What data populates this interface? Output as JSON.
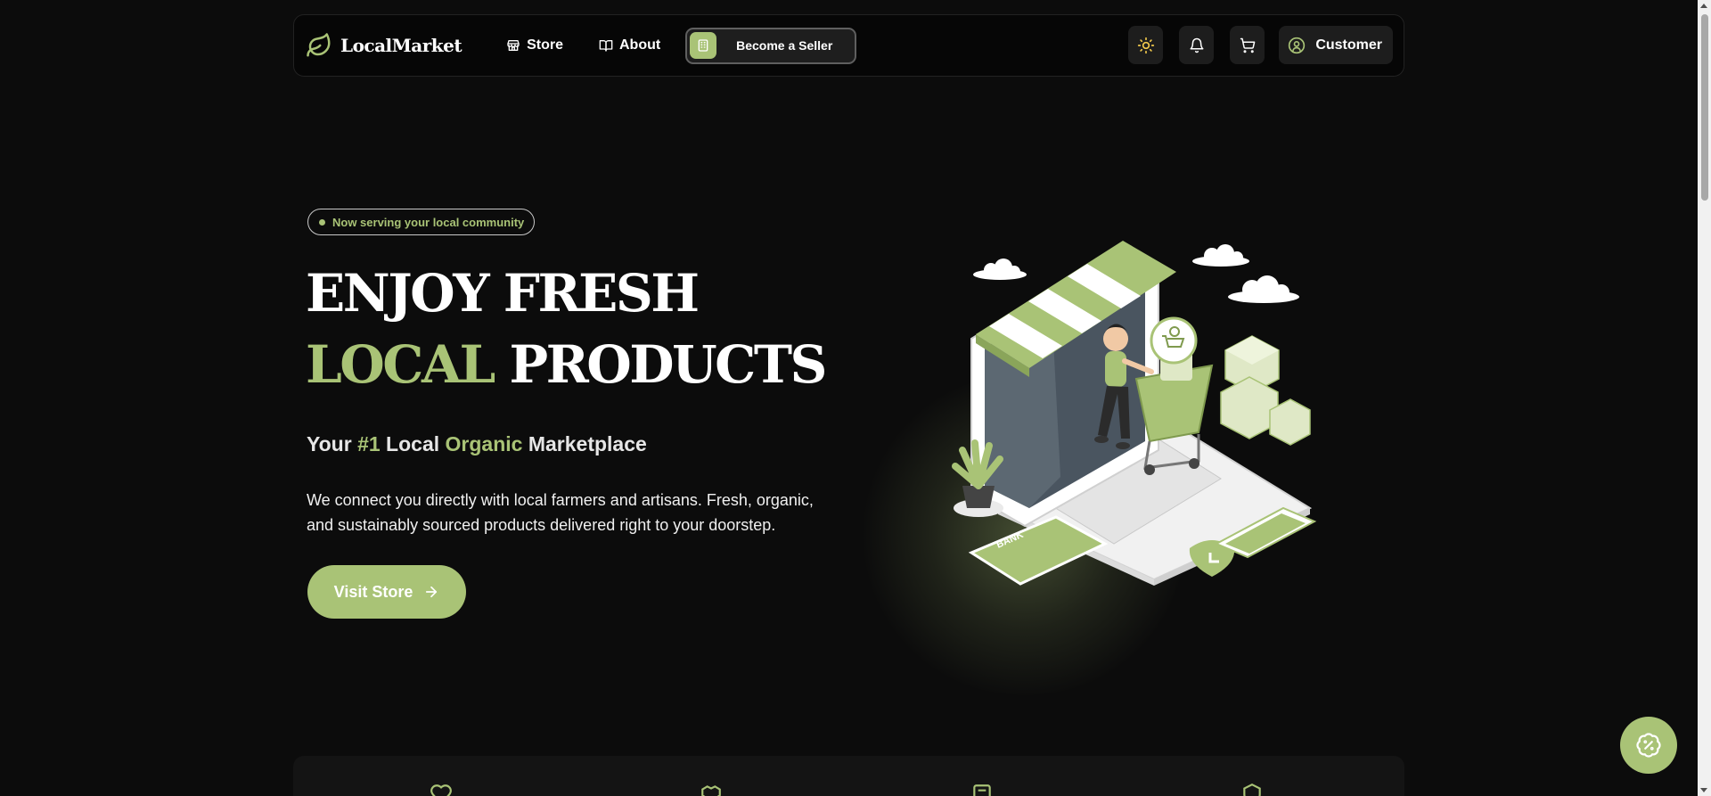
{
  "nav": {
    "brand": "LocalMarket",
    "links": [
      {
        "label": "Store",
        "icon": "store-icon"
      },
      {
        "label": "About",
        "icon": "book-icon"
      }
    ],
    "seller_label": "Become a Seller",
    "customer_label": "Customer"
  },
  "hero": {
    "badge": "Now serving your local community",
    "title_line1": "ENJOY FRESH",
    "title_line2_accent": "LOCAL",
    "title_line2_rest": "PRODUCTS",
    "sub_1": "Your ",
    "sub_2": "#1",
    "sub_3": " Local ",
    "sub_4": "Organic",
    "sub_5": " Marketplace",
    "description": "We connect you directly with local farmers and artisans. Fresh, organic, and sustainably sourced products delivered right to your doorstep.",
    "cta": "Visit Store",
    "illustration_text": "BANK"
  },
  "colors": {
    "accent": "#a9c376",
    "background": "#0c0c0c",
    "nav_bg": "#060606"
  }
}
